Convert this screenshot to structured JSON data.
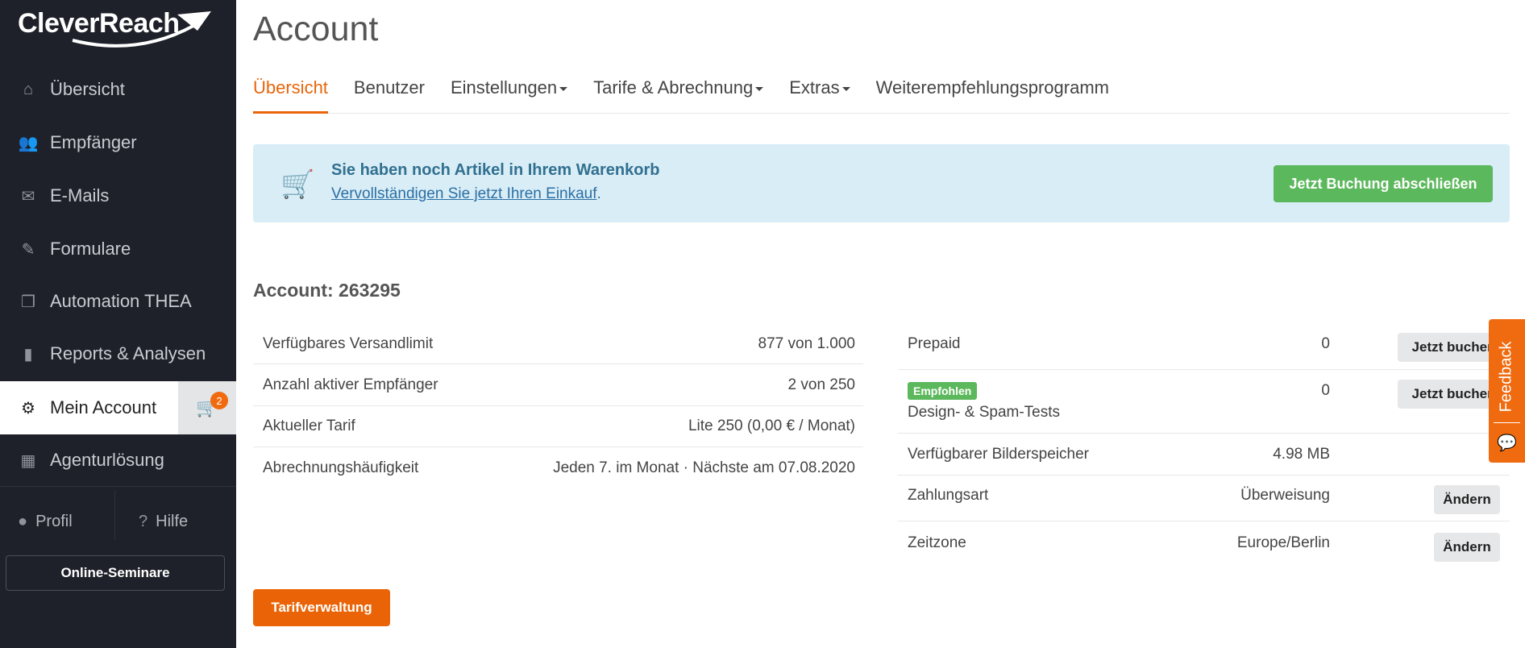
{
  "brand": {
    "logo_text": "CleverReach"
  },
  "sidebar": {
    "items": [
      {
        "label": "Übersicht",
        "icon": "home-icon"
      },
      {
        "label": "Empfänger",
        "icon": "users-icon"
      },
      {
        "label": "E-Mails",
        "icon": "envelope-icon"
      },
      {
        "label": "Formulare",
        "icon": "edit-icon"
      },
      {
        "label": "Automation THEA",
        "icon": "cubes-icon"
      },
      {
        "label": "Reports & Analysen",
        "icon": "bar-chart-icon"
      },
      {
        "label": "Mein Account",
        "icon": "gear-icon"
      },
      {
        "label": "Agenturlösung",
        "icon": "grid-icon"
      }
    ],
    "cart_count": "2",
    "profile": "Profil",
    "help": "Hilfe",
    "seminar": "Online-Seminare"
  },
  "page": {
    "title": "Account"
  },
  "tabs": [
    {
      "label": "Übersicht"
    },
    {
      "label": "Benutzer"
    },
    {
      "label": "Einstellungen"
    },
    {
      "label": "Tarife & Abrechnung"
    },
    {
      "label": "Extras"
    },
    {
      "label": "Weiterempfehlungsprogramm"
    }
  ],
  "alert": {
    "heading": "Sie haben noch Artikel in Ihrem Warenkorb",
    "link": "Vervollständigen Sie jetzt Ihren Einkauf",
    "suffix": ".",
    "button": "Jetzt Buchung abschließen"
  },
  "account": {
    "heading": "Account: 263295",
    "left": [
      {
        "label": "Verfügbares Versandlimit",
        "value": "877 von 1.000"
      },
      {
        "label": "Anzahl aktiver Empfänger",
        "value": "2 von 250"
      },
      {
        "label": "Aktueller Tarif",
        "value": "Lite 250 (0,00 € / Monat)"
      },
      {
        "label": "Abrechnungshäufigkeit",
        "value": "Jeden 7. im Monat · Nächste am 07.08.2020"
      }
    ],
    "right": [
      {
        "label": "Prepaid",
        "value": "0",
        "button": "Jetzt buchen"
      },
      {
        "badge": "Empfohlen",
        "label": "Design- & Spam-Tests",
        "value": "0",
        "button": "Jetzt buchen"
      },
      {
        "label": "Verfügbarer Bilderspeicher",
        "value": "4.98 MB"
      },
      {
        "label": "Zahlungsart",
        "value": "Überweisung",
        "button": "Ändern"
      },
      {
        "label": "Zeitzone",
        "value": "Europe/Berlin",
        "button": "Ändern"
      }
    ],
    "tarif_button": "Tarifverwaltung"
  },
  "feedback": {
    "label": "Feedback"
  }
}
